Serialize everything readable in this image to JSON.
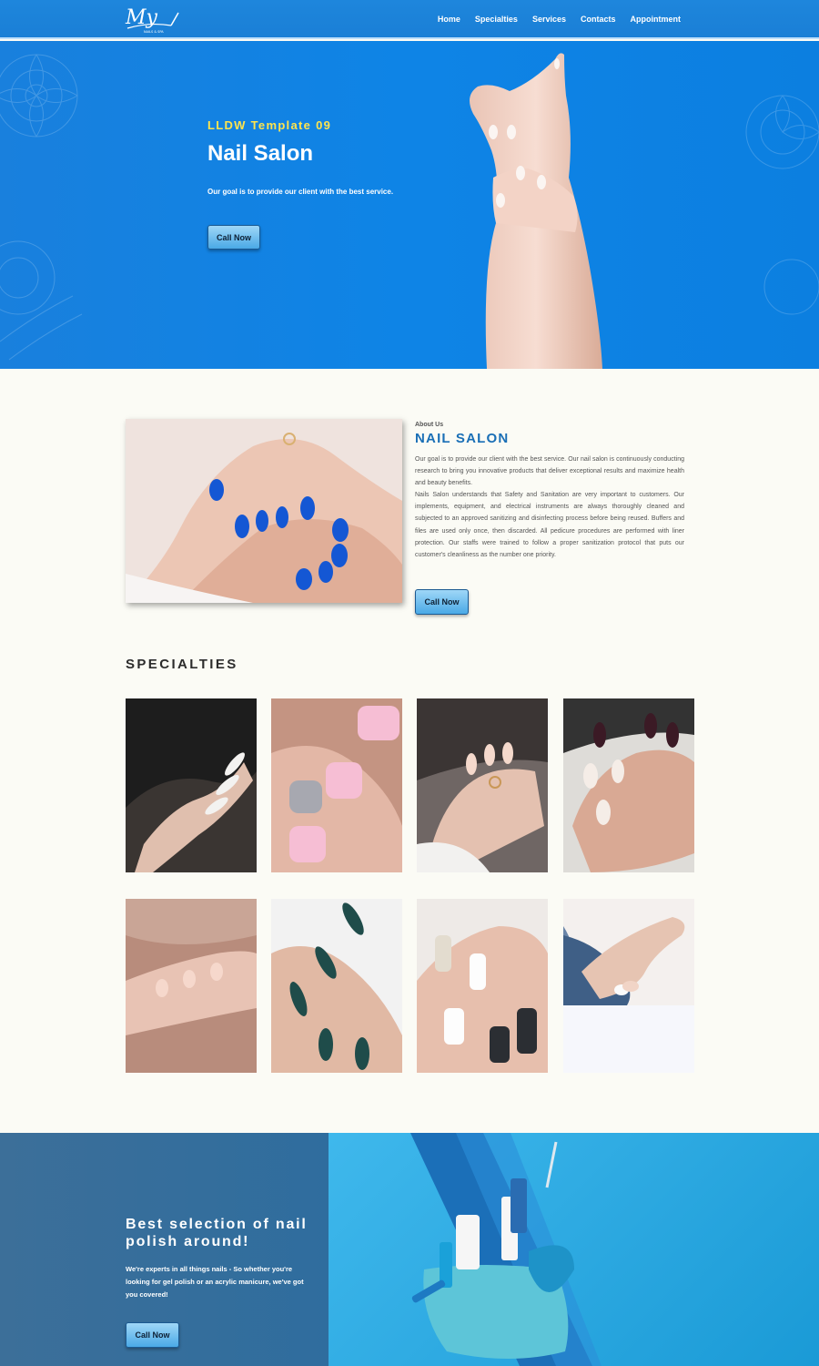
{
  "nav": {
    "logo_text": "My",
    "logo_sub": "NAILS & SPA",
    "links": [
      "Home",
      "Specialties",
      "Services",
      "Contacts",
      "Appointment"
    ]
  },
  "hero": {
    "subtitle": "LLDW Template 09",
    "title": "Nail Salon",
    "text": "Our goal is to provide our client with the best service.",
    "button": "Call Now"
  },
  "about": {
    "label": "About Us",
    "title": "NAIL SALON",
    "paragraph1": "Our goal is to provide our client with the best service. Our nail salon is continuously conducting research to bring you innovative products that deliver exceptional results and maximize health and beauty benefits.",
    "paragraph2": "Nails Salon understands that Safety and Sanitation are very important to customers. Our implements, equipment, and electrical instruments are always thoroughly cleaned and subjected to an approved sanitizing and disinfecting process before being reused. Buffers and files are used only once, then discarded. All pedicure procedures are performed with liner protection. Our staffs were trained to follow a proper sanitization protocol that puts our customer's cleanliness as the number one priority.",
    "button": "Call Now"
  },
  "specialties": {
    "title": "SPECIALTIES"
  },
  "banner": {
    "title": "Best selection of nail polish around!",
    "text": "We're experts in all things nails - So whether you're looking for gel polish or an acrylic manicure, we've got you covered!",
    "button": "Call Now"
  }
}
